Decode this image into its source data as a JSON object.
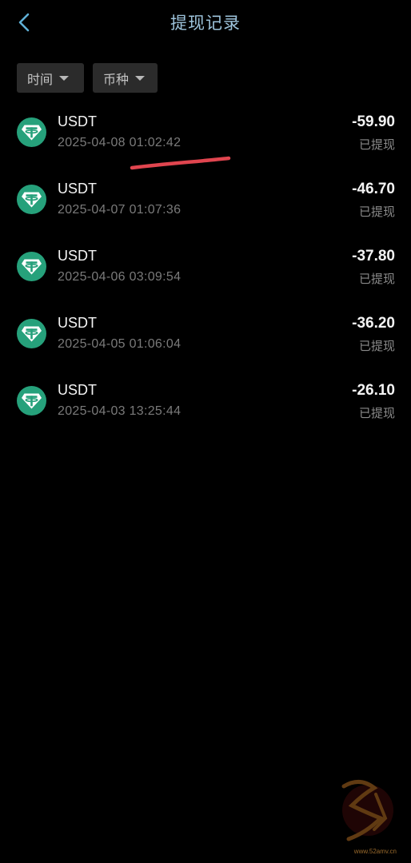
{
  "header": {
    "title": "提现记录",
    "back_icon": "chevron-left-icon"
  },
  "filters": {
    "time_label": "时间",
    "coin_label": "币种"
  },
  "records": [
    {
      "coin": "USDT",
      "date": "2025-04-08 01:02:42",
      "amount": "-59.90",
      "status": "已提现"
    },
    {
      "coin": "USDT",
      "date": "2025-04-07 01:07:36",
      "amount": "-46.70",
      "status": "已提现"
    },
    {
      "coin": "USDT",
      "date": "2025-04-06 03:09:54",
      "amount": "-37.80",
      "status": "已提现"
    },
    {
      "coin": "USDT",
      "date": "2025-04-05 01:06:04",
      "amount": "-36.20",
      "status": "已提现"
    },
    {
      "coin": "USDT",
      "date": "2025-04-03 13:25:44",
      "amount": "-26.10",
      "status": "已提现"
    }
  ],
  "colors": {
    "background": "#000000",
    "title": "#9ec4dc",
    "accent_back": "#5fb0d6",
    "usdt_green": "#26a17b",
    "filter_bg": "#2b2b2b",
    "annotation_red": "#e0454f"
  },
  "watermark": {
    "url_text": "www.52amv.cn"
  }
}
